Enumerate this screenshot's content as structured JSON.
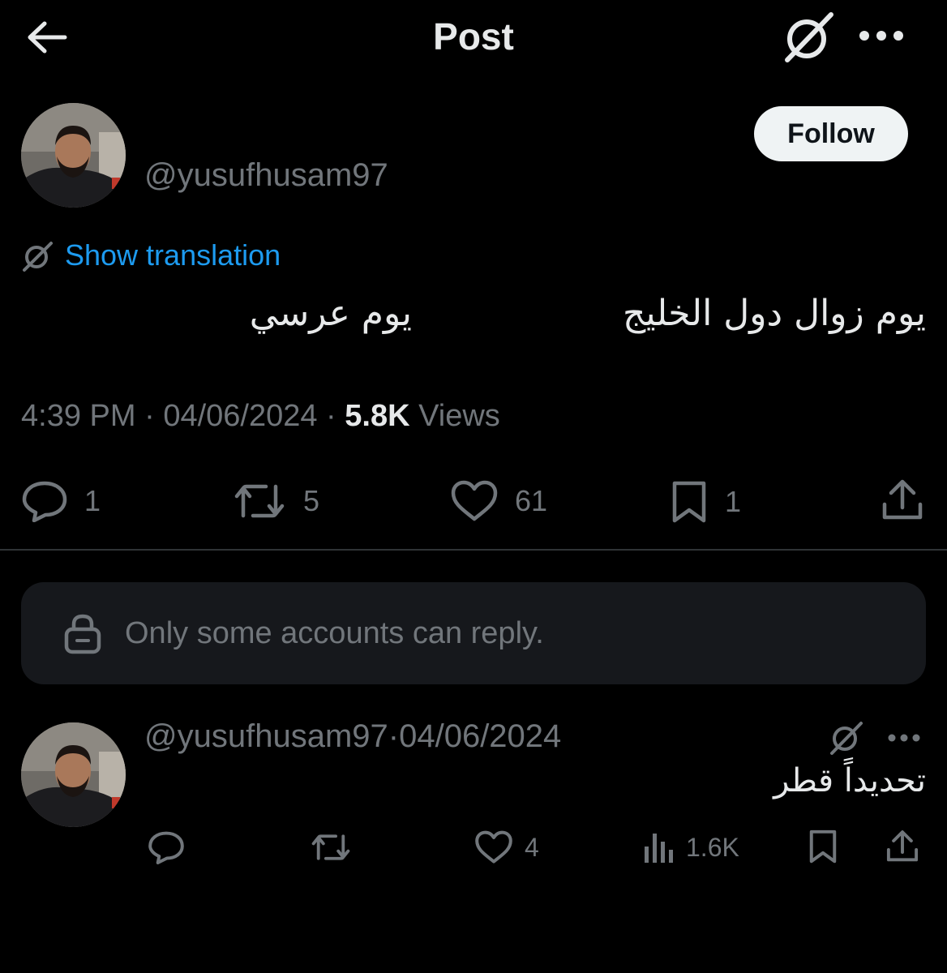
{
  "header": {
    "title": "Post"
  },
  "post": {
    "handle": "@yusufhusam97",
    "follow_label": "Follow",
    "translation_label": "Show translation",
    "text_right": "يوم زوال دول الخليج",
    "text_left": "يوم عرسي",
    "time": "4:39 PM",
    "date": "04/06/2024",
    "views_count": "5.8K",
    "views_label": "Views",
    "stats": {
      "replies": "1",
      "reposts": "5",
      "likes": "61",
      "bookmarks": "1"
    }
  },
  "reply_restriction": {
    "text": "Only some accounts can reply."
  },
  "reply": {
    "handle": "@yusufhusam97",
    "date": "04/06/2024",
    "text": "تحديداً قطر",
    "stats": {
      "likes": "4",
      "views": "1.6K"
    }
  },
  "icons": {
    "back": "arrow-left-icon",
    "grok": "grok-icon",
    "more": "more-horizontal-icon",
    "translate": "grok-icon",
    "reply": "reply-bubble-icon",
    "repost": "repost-icon",
    "like": "heart-icon",
    "bookmark": "bookmark-icon",
    "share": "share-icon",
    "views": "views-bar-icon",
    "lock": "lock-icon"
  },
  "colors": {
    "background": "#000000",
    "text": "#e7e9ea",
    "muted": "#71767b",
    "link": "#1d9bf0",
    "divider": "#2f3336",
    "follow_bg": "#eff3f4"
  }
}
